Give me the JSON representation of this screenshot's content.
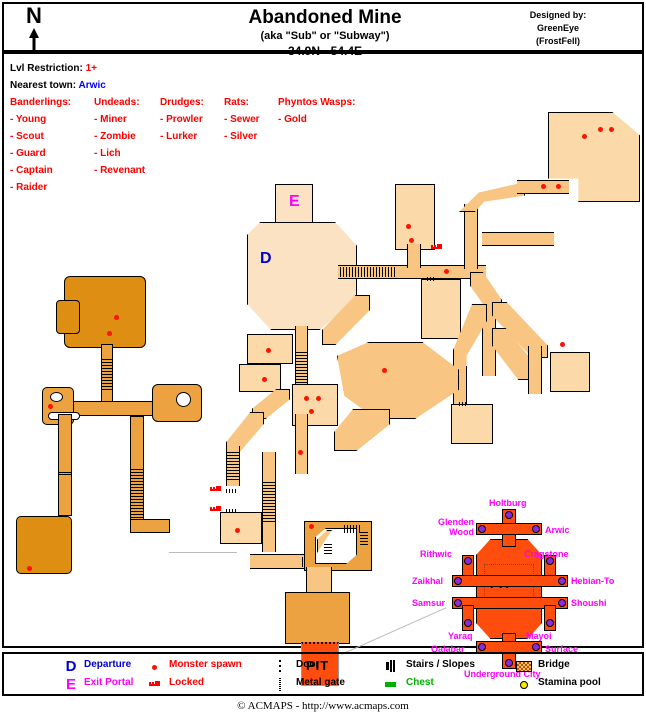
{
  "header": {
    "compass": "N",
    "title": "Abandoned Mine",
    "subtitle": "(aka \"Sub\" or \"Subway\")",
    "coords": "34.9N - 54.4E",
    "designed_by_label": "Designed by:",
    "designer_name": "GreenEye",
    "designer_server": "(FrostFell)"
  },
  "info": {
    "lvl_label": "Lvl Restriction:",
    "lvl_value": "1+",
    "town_label": "Nearest town:",
    "town_value": "Arwic"
  },
  "monsters": [
    {
      "heading": "Banderlings:",
      "items": [
        "- Young",
        "- Scout",
        "- Guard",
        "- Captain",
        "- Raider"
      ]
    },
    {
      "heading": "Undeads:",
      "items": [
        "- Miner",
        "- Zombie",
        "- Lich",
        "- Revenant"
      ]
    },
    {
      "heading": "Drudges:",
      "items": [
        "- Prowler",
        "- Lurker"
      ]
    },
    {
      "heading": "Rats:",
      "items": [
        "- Sewer",
        "- Silver"
      ]
    },
    {
      "heading": "Phyntos Wasps:",
      "items": [
        "- Gold"
      ]
    }
  ],
  "map": {
    "room_departure_label": "D",
    "room_exit_portal_label": "E",
    "pit_label": "PIT"
  },
  "pit_diagram": {
    "center_label": "PIT",
    "destinations": [
      "Holtburg",
      "Glenden Wood",
      "Arwic",
      "Rithwic",
      "Cragstone",
      "Zaikhal",
      "Hebian-To",
      "Samsur",
      "Shoushi",
      "Yaraq",
      "Mayoi",
      "Qalabar",
      "Surface",
      "Underground City"
    ]
  },
  "legend": [
    {
      "icon": "departure-letter-icon",
      "label": "Departure",
      "color": "#0000cc"
    },
    {
      "icon": "exit-portal-letter-icon",
      "label": "Exit Portal",
      "color": "#ff00ff"
    },
    {
      "icon": "monster-spawn-dot-icon",
      "label": "Monster spawn",
      "color": "#ff0000"
    },
    {
      "icon": "locked-key-icon",
      "label": "Locked",
      "color": "#ff0000"
    },
    {
      "icon": "door-icon",
      "label": "Door",
      "color": "#000000"
    },
    {
      "icon": "metal-gate-icon",
      "label": "Metal gate",
      "color": "#000000"
    },
    {
      "icon": "stairs-slopes-icon",
      "label": "Stairs / Slopes",
      "color": "#000000"
    },
    {
      "icon": "chest-icon",
      "label": "Chest",
      "color": "#00b000"
    },
    {
      "icon": "bridge-icon",
      "label": "Bridge",
      "color": "#b06000"
    },
    {
      "icon": "stamina-pool-icon",
      "label": "Stamina pool",
      "color": "#000000"
    }
  ],
  "footer": {
    "copyright": "© ACMAPS - http://www.acmaps.com"
  },
  "colors": {
    "room_fill": "#fbd9a8",
    "corridor_fill": "#f8c583",
    "cave_fill": "#dd8e13",
    "cave_corridor_fill": "#eda241",
    "pit_fill": "#ff4d0d",
    "pale_room_fill": "#fbe2c3",
    "spawn": "#ff1200",
    "portal_dot": "#8a2be2",
    "portal_text": "#ff00ff"
  }
}
